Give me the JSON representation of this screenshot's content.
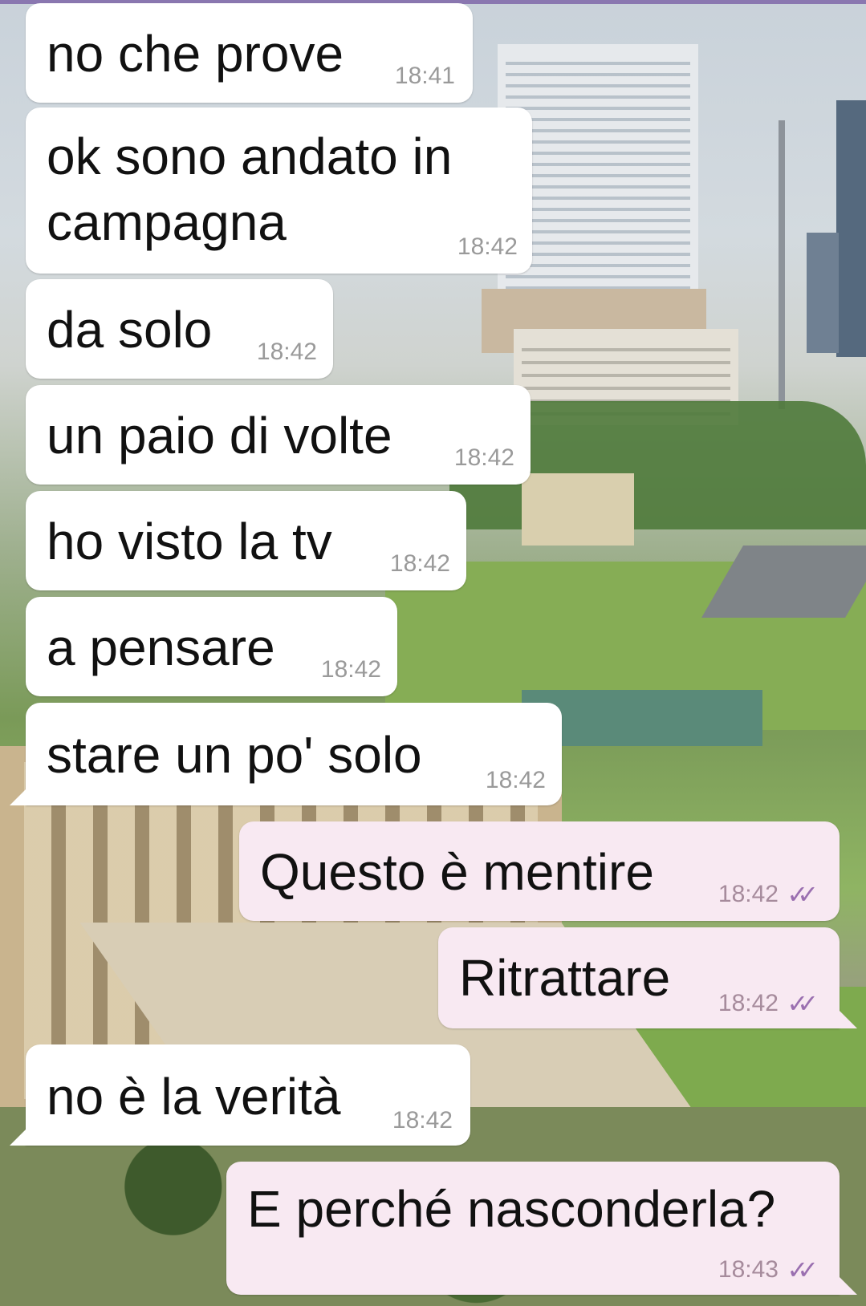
{
  "wallpaper": {
    "accent_bar_color": "#8a77b0"
  },
  "incoming_bubble_color": "#ffffff",
  "outgoing_bubble_color": "#f8e9f2",
  "read_tick_color": "#9a6fb0",
  "read_tick_icon": "double-check-icon",
  "messages": [
    {
      "text": "no che prove",
      "time": "18:41",
      "direction": "incoming"
    },
    {
      "text": "ok sono andato in\ncampagna",
      "time": "18:42",
      "direction": "incoming"
    },
    {
      "text": "da solo",
      "time": "18:42",
      "direction": "incoming"
    },
    {
      "text": "un paio di volte",
      "time": "18:42",
      "direction": "incoming"
    },
    {
      "text": "ho visto la tv",
      "time": "18:42",
      "direction": "incoming"
    },
    {
      "text": "a pensare",
      "time": "18:42",
      "direction": "incoming"
    },
    {
      "text": "stare un po' solo",
      "time": "18:42",
      "direction": "incoming"
    },
    {
      "text": "Questo è mentire",
      "time": "18:42",
      "direction": "outgoing",
      "read": true
    },
    {
      "text": "Ritrattare",
      "time": "18:42",
      "direction": "outgoing",
      "read": true
    },
    {
      "text": "no è la verità",
      "time": "18:42",
      "direction": "incoming"
    },
    {
      "text": "E perché nasconderla?",
      "time": "18:43",
      "direction": "outgoing",
      "read": true
    }
  ]
}
